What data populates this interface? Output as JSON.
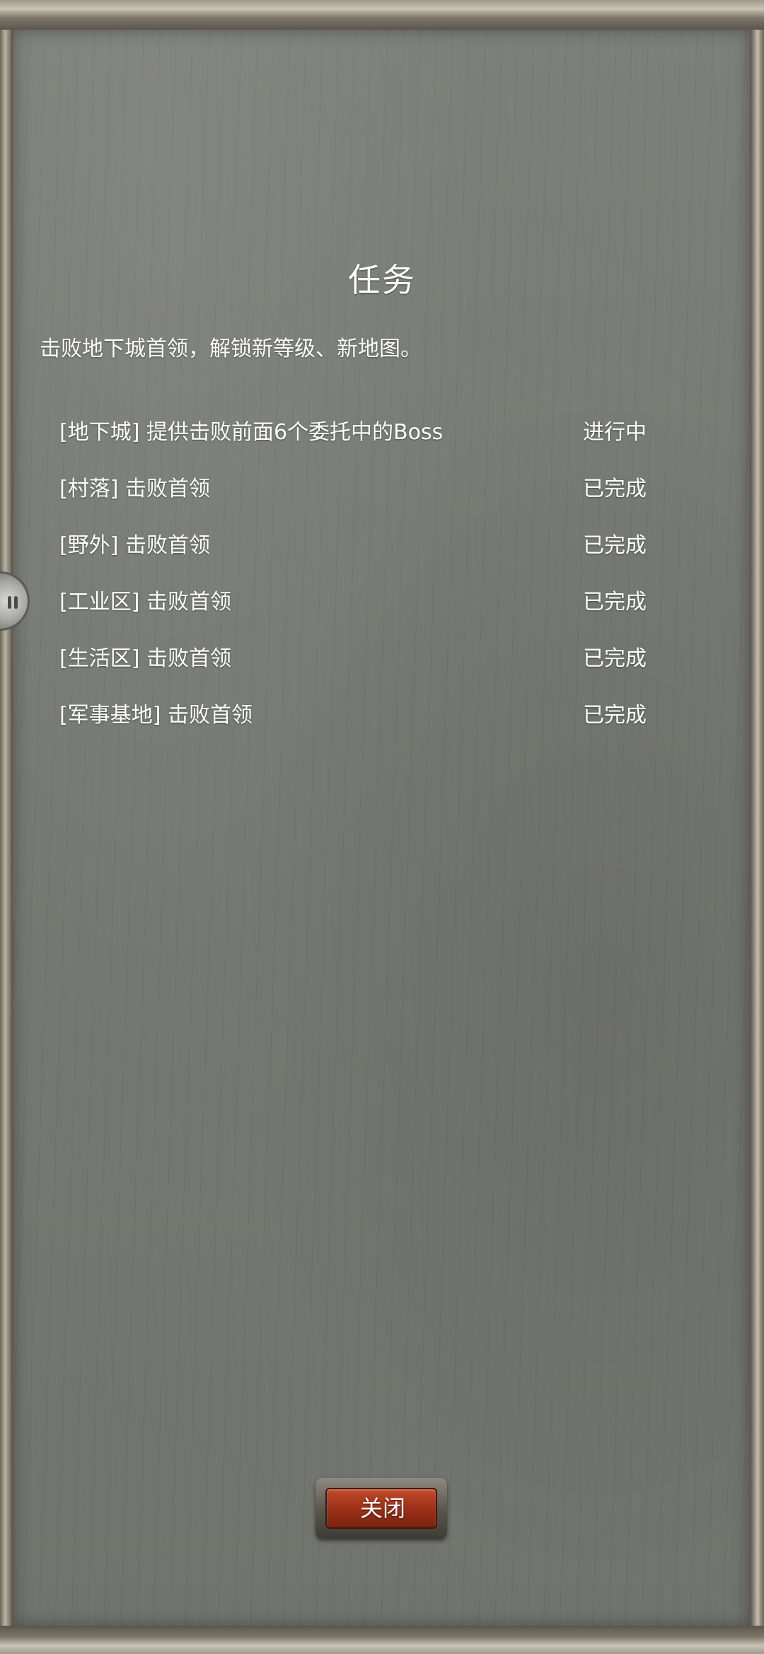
{
  "dialog": {
    "title": "任务",
    "description": "击败地下城首领，解锁新等级、新地图。",
    "close_label": "关闭"
  },
  "tasks": [
    {
      "name": "[地下城] 提供击败前面6个委托中的Boss",
      "status": "进行中"
    },
    {
      "name": "[村落] 击败首领",
      "status": "已完成"
    },
    {
      "name": "[野外] 击败首领",
      "status": "已完成"
    },
    {
      "name": "[工业区] 击败首领",
      "status": "已完成"
    },
    {
      "name": "[生活区] 击败首领",
      "status": "已完成"
    },
    {
      "name": "[军事基地] 击败首领",
      "status": "已完成"
    }
  ],
  "icons": {
    "side_handle": "pause-icon"
  },
  "colors": {
    "panel": "#777974",
    "text": "#ffffff",
    "button": "#9a2f17"
  }
}
